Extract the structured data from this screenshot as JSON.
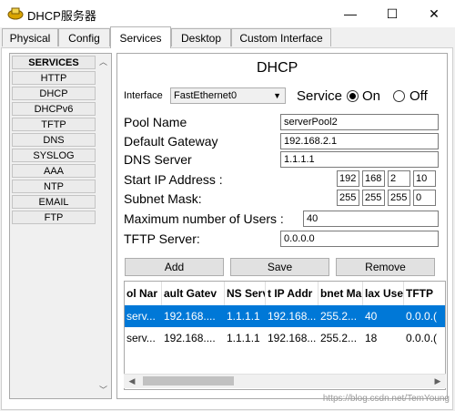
{
  "window": {
    "title": "DHCP服务器",
    "minimize": "—",
    "maximize": "☐",
    "close": "✕"
  },
  "tabs": [
    "Physical",
    "Config",
    "Services",
    "Desktop",
    "Custom Interface"
  ],
  "sidebar": {
    "header": "SERVICES",
    "items": [
      "HTTP",
      "DHCP",
      "DHCPv6",
      "TFTP",
      "DNS",
      "SYSLOG",
      "AAA",
      "NTP",
      "EMAIL",
      "FTP"
    ]
  },
  "dhcp": {
    "heading": "DHCP",
    "interface_label": "Interface",
    "interface_value": "FastEthernet0",
    "service_label": "Service",
    "on_label": "On",
    "off_label": "Off",
    "service_state": "On",
    "pool_name_label": "Pool Name",
    "pool_name_value": "serverPool2",
    "gateway_label": "Default Gateway",
    "gateway_value": "192.168.2.1",
    "dns_label": "DNS Server",
    "dns_value": "1.1.1.1",
    "start_ip_label": "Start IP Address :",
    "start_ip": [
      "192",
      "168",
      "2",
      "10"
    ],
    "mask_label": "Subnet Mask:",
    "mask": [
      "255",
      "255",
      "255",
      "0"
    ],
    "max_users_label": "Maximum number of Users :",
    "max_users_value": "40",
    "tftp_label": "TFTP Server:",
    "tftp_value": "0.0.0.0",
    "add_button": "Add",
    "save_button": "Save",
    "remove_button": "Remove"
  },
  "table": {
    "headers": [
      "ol Nar",
      "ault Gatev",
      "NS Serv",
      "t IP Addr",
      "bnet Ma",
      "lax Use",
      "TFTP"
    ],
    "rows": [
      [
        "serv...",
        "192.168....",
        "1.1.1.1",
        "192.168...",
        "255.2...",
        "40",
        "0.0.0.("
      ],
      [
        "serv...",
        "192.168....",
        "1.1.1.1",
        "192.168...",
        "255.2...",
        "18",
        "0.0.0.("
      ]
    ],
    "selected_row": 0
  },
  "watermark": "https://blog.csdn.net/TemYoung",
  "colors": {
    "selection": "#0078d7",
    "accent_icon": "#c8a000"
  }
}
